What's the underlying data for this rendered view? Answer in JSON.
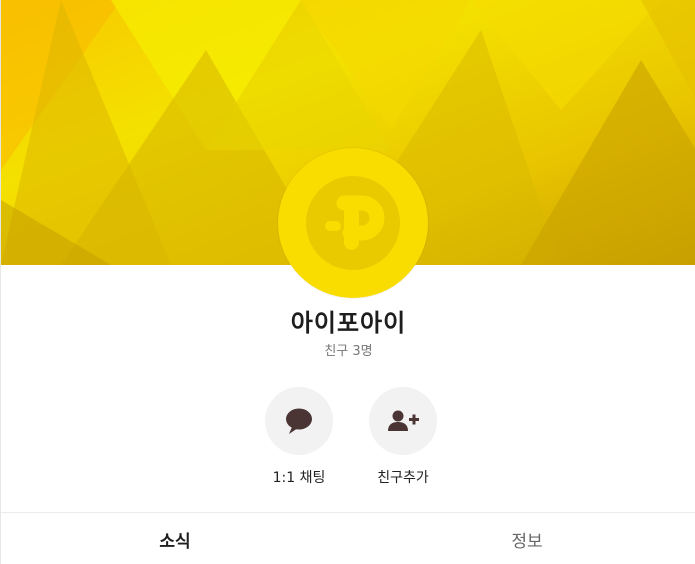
{
  "profile": {
    "name": "아이포아이",
    "friends_count": "친구 3명",
    "cover_colors": [
      "#f7c400",
      "#f3e500",
      "#c9a800"
    ],
    "avatar_color": "#f9dc00",
    "avatar_icon": "p-logo-icon"
  },
  "actions": [
    {
      "label": "1:1 채팅",
      "icon": "chat-bubble-icon"
    },
    {
      "label": "친구추가",
      "icon": "add-friend-icon"
    }
  ],
  "tabs": [
    {
      "label": "소식",
      "active": true
    },
    {
      "label": "정보",
      "active": false
    }
  ]
}
